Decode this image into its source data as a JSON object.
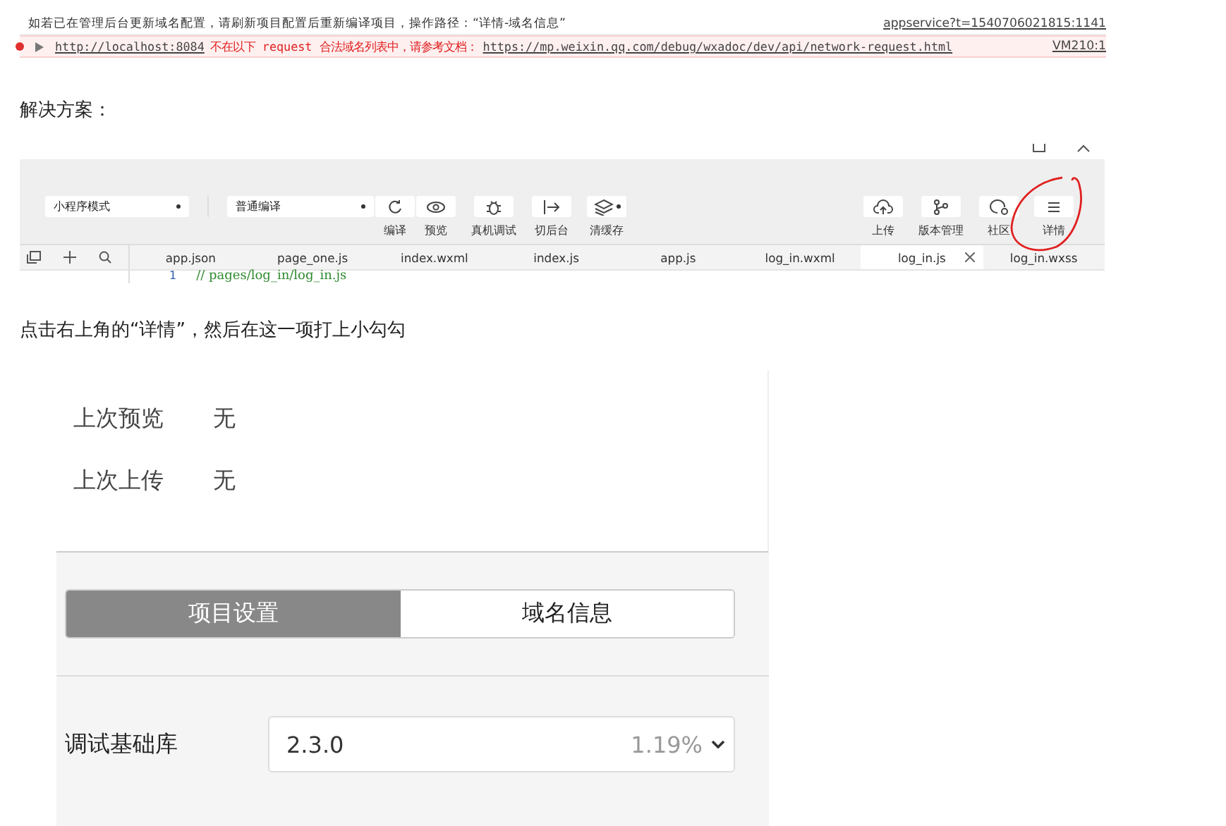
{
  "console": [
    {
      "kind": "info",
      "message": "如若已在管理后台更新域名配置，请刷新项目配置后重新编译项目，操作路径：“详情-域名信息”",
      "source": "appservice?t=1540706021815:1141"
    },
    {
      "kind": "error",
      "url": "http://localhost:8084",
      "message": "不在以下 request 合法域名列表中，请参考文档：",
      "link": "https://mp.weixin.qq.com/debug/wxadoc/dev/api/network-request.html",
      "source": "VM210:1"
    }
  ],
  "heading": "解决方案：",
  "ide": {
    "mode_select": "小程序模式",
    "compile_select": "普通编译",
    "left_tools": [
      {
        "label": "编译"
      },
      {
        "label": "预览"
      },
      {
        "label": "真机调试"
      },
      {
        "label": "切后台"
      },
      {
        "label": "清缓存"
      }
    ],
    "right_tools": [
      {
        "label": "上传"
      },
      {
        "label": "版本管理"
      },
      {
        "label": "社区"
      },
      {
        "label": "详情"
      }
    ],
    "tabs": [
      {
        "label": "app.json",
        "selected": false
      },
      {
        "label": "page_one.js",
        "selected": false
      },
      {
        "label": "index.wxml",
        "selected": false
      },
      {
        "label": "index.js",
        "selected": false
      },
      {
        "label": "app.js",
        "selected": false
      },
      {
        "label": "log_in.wxml",
        "selected": false
      },
      {
        "label": "log_in.js",
        "selected": true
      },
      {
        "label": "log_in.wxss",
        "selected": false
      }
    ],
    "code_line": {
      "number": "1",
      "text": "// pages/log_in/log_in.js"
    }
  },
  "caption": "点击右上角的“详情”，然后在这一项打上小勾勾",
  "details": {
    "rows": [
      {
        "label": "上次预览",
        "value": "无"
      },
      {
        "label": "上次上传",
        "value": "无"
      }
    ],
    "segments": [
      {
        "label": "项目设置",
        "selected": true
      },
      {
        "label": "域名信息",
        "selected": false
      }
    ],
    "setting": {
      "label": "调试基础库",
      "value": "2.3.0",
      "note": "1.19%"
    }
  }
}
